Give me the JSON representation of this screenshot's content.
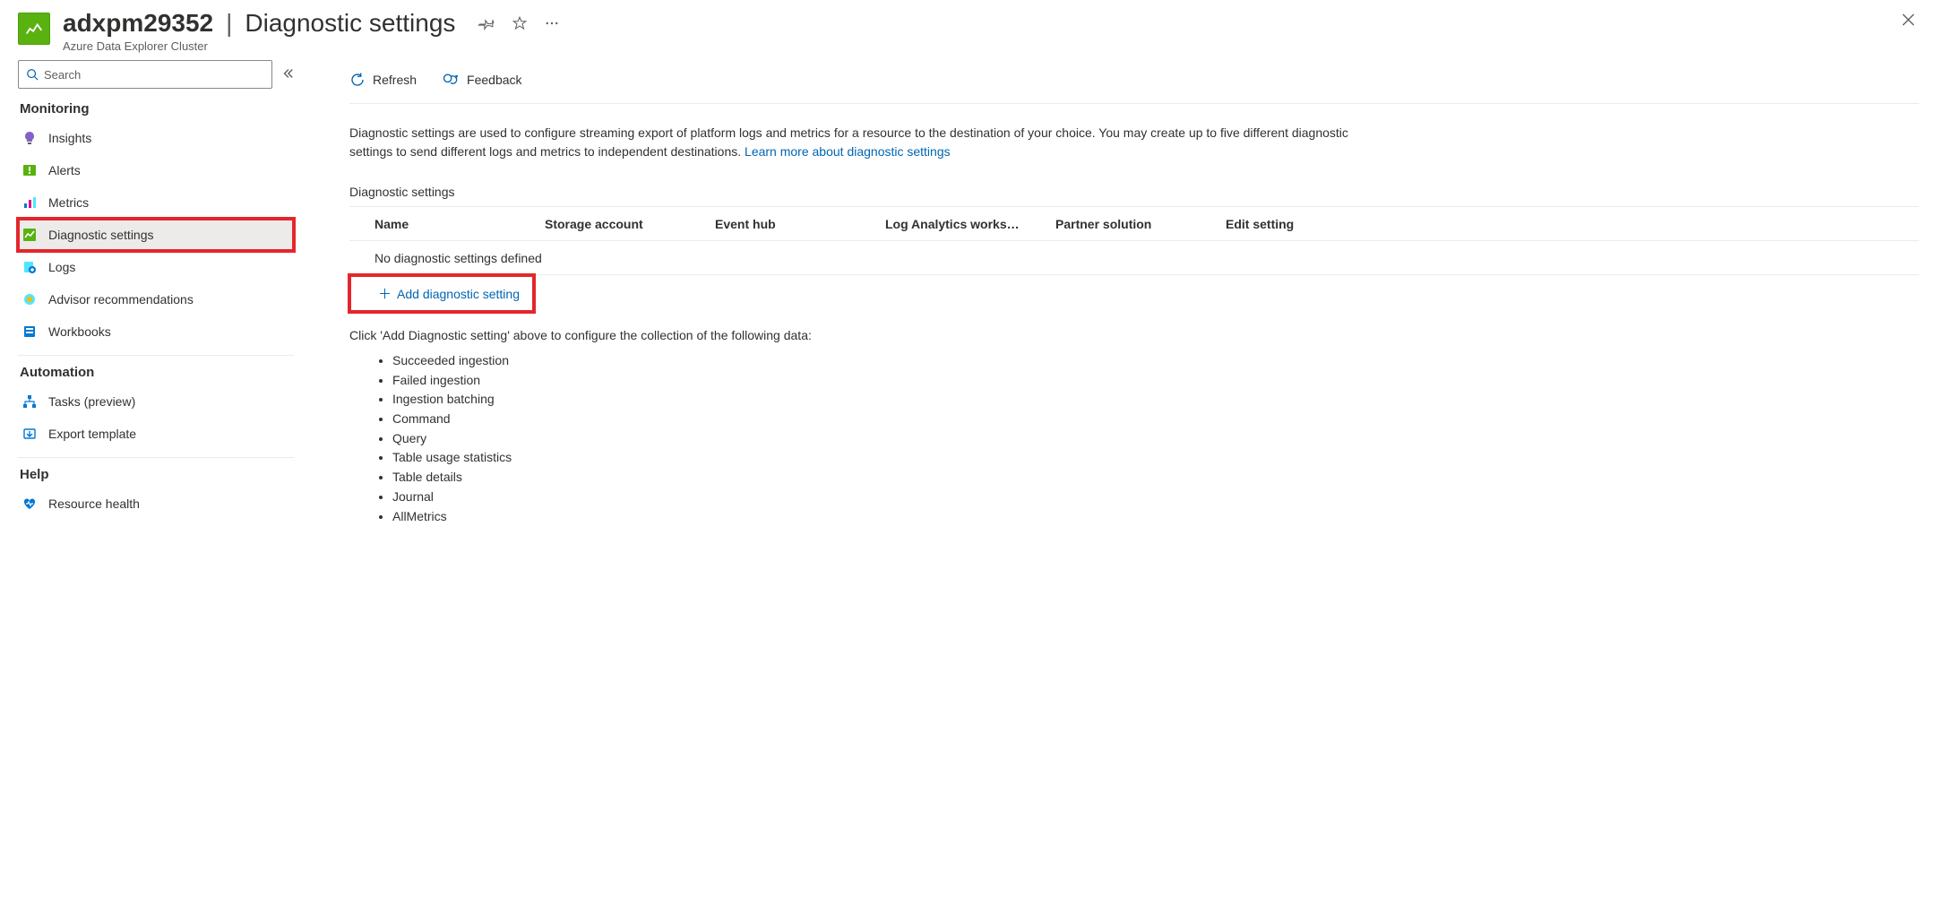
{
  "header": {
    "resourceName": "adxpm29352",
    "pageTitle": "Diagnostic settings",
    "subtitle": "Azure Data Explorer Cluster"
  },
  "search": {
    "placeholder": "Search"
  },
  "sidebar": {
    "groups": [
      {
        "title": "Monitoring",
        "items": [
          {
            "key": "insights",
            "label": "Insights",
            "icon": "bulb"
          },
          {
            "key": "alerts",
            "label": "Alerts",
            "icon": "alert"
          },
          {
            "key": "metrics",
            "label": "Metrics",
            "icon": "metrics"
          },
          {
            "key": "diagnostic",
            "label": "Diagnostic settings",
            "icon": "diagnostic",
            "selected": true,
            "highlight": true
          },
          {
            "key": "logs",
            "label": "Logs",
            "icon": "logs"
          },
          {
            "key": "advisor",
            "label": "Advisor recommendations",
            "icon": "advisor"
          },
          {
            "key": "workbooks",
            "label": "Workbooks",
            "icon": "workbooks"
          }
        ]
      },
      {
        "title": "Automation",
        "items": [
          {
            "key": "tasks",
            "label": "Tasks (preview)",
            "icon": "tasks"
          },
          {
            "key": "export",
            "label": "Export template",
            "icon": "export"
          }
        ]
      },
      {
        "title": "Help",
        "items": [
          {
            "key": "resourcehealth",
            "label": "Resource health",
            "icon": "health"
          }
        ]
      }
    ]
  },
  "toolbar": {
    "refresh": "Refresh",
    "feedback": "Feedback"
  },
  "description": {
    "text": "Diagnostic settings are used to configure streaming export of platform logs and metrics for a resource to the destination of your choice. You may create up to five different diagnostic settings to send different logs and metrics to independent destinations. ",
    "linkText": "Learn more about diagnostic settings"
  },
  "table": {
    "sectionLabel": "Diagnostic settings",
    "columns": [
      "Name",
      "Storage account",
      "Event hub",
      "Log Analytics works…",
      "Partner solution",
      "Edit setting"
    ],
    "emptyText": "No diagnostic settings defined",
    "addLabel": "Add diagnostic setting"
  },
  "hint": "Click 'Add Diagnostic setting' above to configure the collection of the following data:",
  "dataCategories": [
    "Succeeded ingestion",
    "Failed ingestion",
    "Ingestion batching",
    "Command",
    "Query",
    "Table usage statistics",
    "Table details",
    "Journal",
    "AllMetrics"
  ]
}
